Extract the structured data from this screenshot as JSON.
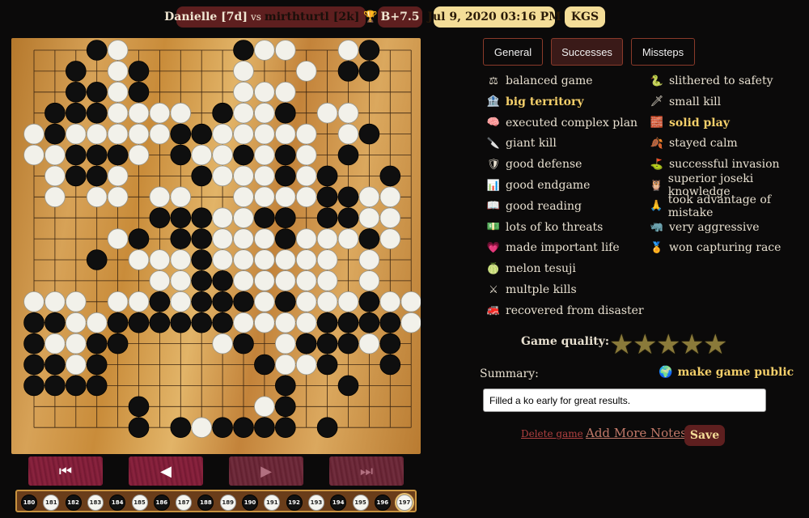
{
  "header": {
    "black_player": "Danielle [7d]",
    "vs": "vs",
    "white_player": "mirthturtl [2k]",
    "trophy_icon": "trophy-icon",
    "result": "B+7.5",
    "date": "Jul 9, 2020 03:16 PM",
    "server": "KGS"
  },
  "board": {
    "size": 19,
    "white": [
      "C1",
      "D1",
      "D3",
      "E3",
      "K1",
      "K2",
      "M2",
      "N2",
      "M3",
      "A3",
      "B3",
      "B4",
      "C4",
      "B5",
      "C5",
      "A6",
      "A7",
      "B7",
      "A8",
      "B8",
      "C8",
      "D8",
      "D7",
      "F8",
      "H8",
      "G7",
      "K7",
      "K8",
      "L8",
      "M8",
      "N8",
      "O8",
      "P8",
      "R8",
      "S8",
      "K9",
      "O9",
      "O10",
      "M10",
      "N10",
      "S10",
      "H10",
      "J10",
      "L10",
      "S11",
      "R11",
      "P11",
      "O11",
      "N11",
      "L11",
      "K11",
      "J11",
      "H11",
      "F12",
      "F11",
      "G12",
      "K12",
      "L12",
      "M12",
      "N12",
      "O12",
      "H13",
      "J13",
      "P13",
      "L14",
      "N14",
      "P14",
      "Q14",
      "F15",
      "G15",
      "J15",
      "K15",
      "L15",
      "M15",
      "N15",
      "P15",
      "Q15",
      "S15",
      "B16",
      "D16",
      "E16",
      "F16",
      "G16",
      "K16",
      "L16",
      "M16",
      "N16",
      "Q16",
      "C17",
      "D17",
      "K17",
      "L17",
      "N17",
      "F18",
      "B18",
      "M18",
      "L18",
      "C18",
      "A18",
      "A19",
      "E19",
      "F19",
      "G19",
      "I19",
      "M19",
      "N19",
      "O19",
      "O20",
      "D20",
      "E20",
      "F20",
      "G20",
      "H20",
      "L20",
      "M20",
      "N20",
      "F21",
      "I21",
      "O21",
      "M22",
      "P22",
      "P23",
      "O23",
      "E22",
      "E23",
      "F23",
      "F24",
      "Q24",
      "Q25"
    ],
    "black": [
      "D10",
      "F15x"
    ],
    "current_move": 197
  },
  "tabs": [
    "General",
    "Successes",
    "Missteps"
  ],
  "active_tab": "Successes",
  "successes_left": [
    {
      "icon": "scales-icon",
      "label": "balanced game",
      "hl": false
    },
    {
      "icon": "building-icon",
      "label": "big territory",
      "hl": true
    },
    {
      "icon": "brain-icon",
      "label": "executed complex plan",
      "hl": false
    },
    {
      "icon": "knife-icon",
      "label": "giant kill",
      "hl": false
    },
    {
      "icon": "shield-icon",
      "label": "good defense",
      "hl": false
    },
    {
      "icon": "chart-icon",
      "label": "good endgame",
      "hl": false
    },
    {
      "icon": "book-icon",
      "label": "good reading",
      "hl": false
    },
    {
      "icon": "money-icon",
      "label": "lots of ko threats",
      "hl": false
    },
    {
      "icon": "heart-icon",
      "label": "made important life",
      "hl": false
    },
    {
      "icon": "melon-icon",
      "label": "melon tesuji",
      "hl": false
    },
    {
      "icon": "crossed-swords-icon",
      "label": "multple kills",
      "hl": false
    },
    {
      "icon": "fire-truck-icon",
      "label": "recovered from disaster",
      "hl": false
    }
  ],
  "successes_right": [
    {
      "icon": "snake-icon",
      "label": "slithered to safety",
      "hl": false
    },
    {
      "icon": "dagger-icon",
      "label": "small kill",
      "hl": false
    },
    {
      "icon": "bricks-icon",
      "label": "solid play",
      "hl": true
    },
    {
      "icon": "leaf-icon",
      "label": "stayed calm",
      "hl": false
    },
    {
      "icon": "golf-flag-icon",
      "label": "successful invasion",
      "hl": false
    },
    {
      "icon": "owl-icon",
      "label": "superior joseki knowledge",
      "hl": false
    },
    {
      "icon": "praying-hands-icon",
      "label": "took advantage of mistake",
      "hl": false
    },
    {
      "icon": "rhino-icon",
      "label": "very aggressive",
      "hl": false
    },
    {
      "icon": "medal-icon",
      "label": "won capturing race",
      "hl": false
    }
  ],
  "quality": {
    "label": "Game quality:",
    "stars": 5,
    "rating": 0
  },
  "summary": {
    "label": "Summary:",
    "public_label": "make game public",
    "value": "Filled a ko early for great results."
  },
  "actions": {
    "delete": "Delete game",
    "add_notes": "Add More Notes",
    "save": "Save"
  },
  "moves": [
    {
      "n": "180",
      "c": "b"
    },
    {
      "n": "181",
      "c": "w"
    },
    {
      "n": "182",
      "c": "b"
    },
    {
      "n": "183",
      "c": "w"
    },
    {
      "n": "184",
      "c": "b"
    },
    {
      "n": "185",
      "c": "w"
    },
    {
      "n": "186",
      "c": "b"
    },
    {
      "n": "187",
      "c": "w"
    },
    {
      "n": "188",
      "c": "b"
    },
    {
      "n": "189",
      "c": "w"
    },
    {
      "n": "190",
      "c": "b"
    },
    {
      "n": "191",
      "c": "w"
    },
    {
      "n": "192",
      "c": "b"
    },
    {
      "n": "193",
      "c": "w"
    },
    {
      "n": "194",
      "c": "b"
    },
    {
      "n": "195",
      "c": "w"
    },
    {
      "n": "196",
      "c": "b"
    },
    {
      "n": "197",
      "c": "w"
    }
  ]
}
